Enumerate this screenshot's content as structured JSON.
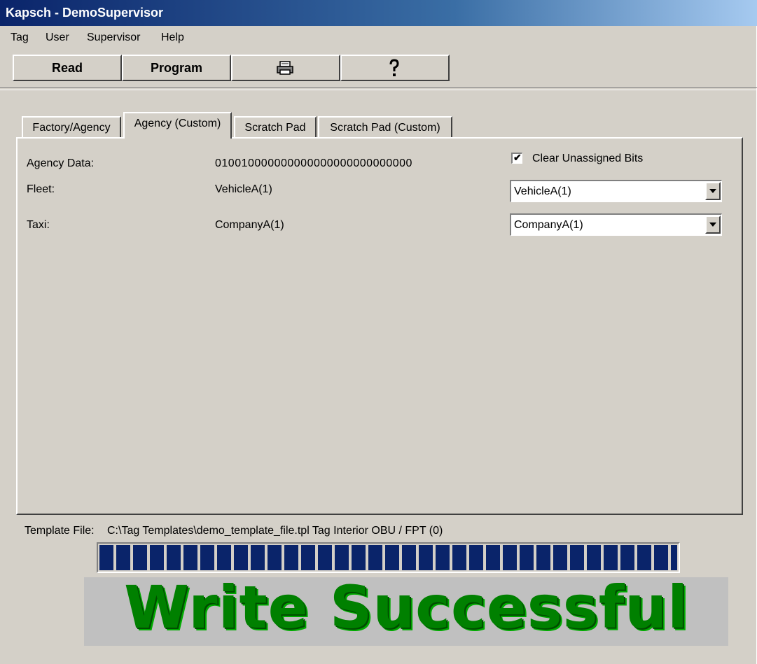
{
  "window": {
    "title": "Kapsch - DemoSupervisor"
  },
  "menu": {
    "items": [
      "Tag",
      "User",
      "Supervisor",
      "Help"
    ]
  },
  "toolbar": {
    "read_label": "Read",
    "program_label": "Program",
    "print_icon": "printer-icon",
    "help_icon": "help-icon"
  },
  "tabs": [
    "Factory/Agency",
    "Agency (Custom)",
    "Scratch Pad",
    "Scratch Pad (Custom)"
  ],
  "active_tab": "Agency (Custom)",
  "agency": {
    "agency_data_label": "Agency Data:",
    "agency_data_value": "010010000000000000000000000000",
    "fleet_label": "Fleet:",
    "fleet_value": "VehicleA(1)",
    "taxi_label": "Taxi:",
    "taxi_value": "CompanyA(1)",
    "clear_bits_label": "Clear Unassigned Bits",
    "clear_bits_checked": true,
    "fleet_select": "VehicleA(1)",
    "taxi_select": "CompanyA(1)"
  },
  "status": {
    "template_label": "Template File:",
    "template_value": "C:\\Tag Templates\\demo_template_file.tpl Tag Interior OBU / FPT (0)",
    "progress": 1.0,
    "message": "Write Successful"
  },
  "colors": {
    "title_blue": "#0a246a",
    "progress_blue": "#0a246a",
    "success_green": "#008000",
    "face": "#d4d0c8"
  }
}
